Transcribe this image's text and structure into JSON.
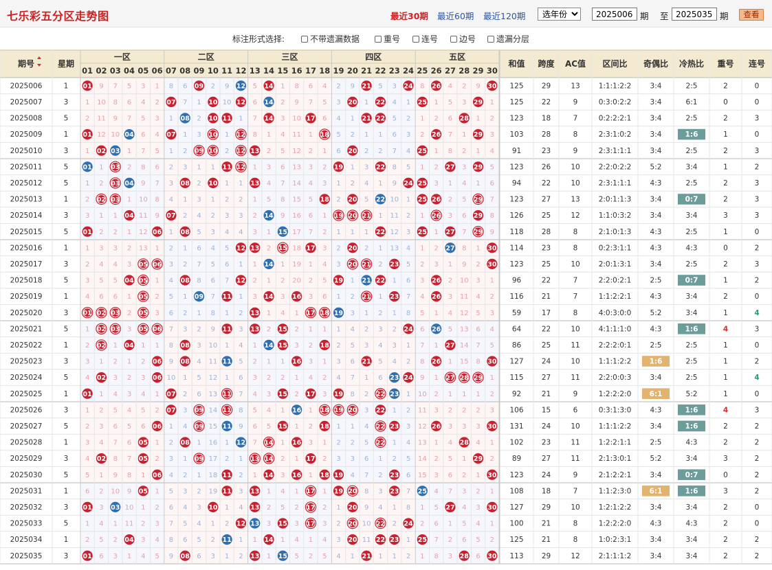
{
  "header": {
    "title": "七乐彩五分区走势图",
    "ranges": [
      "最近30期",
      "最近60期",
      "最近120期"
    ],
    "year_select": "选年份",
    "from_issue": "2025006",
    "issue_unit": "期",
    "to_label": "至",
    "to_issue": "2025035",
    "query_button": "查看"
  },
  "options": {
    "label": "标注形式选择:",
    "items": [
      "不带遗漏数据",
      "重号",
      "连号",
      "边号",
      "遗漏分层"
    ]
  },
  "columns": {
    "issue": "期号",
    "weekday": "星期",
    "zones": [
      "一区",
      "二区",
      "三区",
      "四区",
      "五区"
    ],
    "numbers": [
      "01",
      "02",
      "03",
      "04",
      "05",
      "06",
      "07",
      "08",
      "09",
      "10",
      "11",
      "12",
      "13",
      "14",
      "15",
      "16",
      "17",
      "18",
      "19",
      "20",
      "21",
      "22",
      "23",
      "24",
      "25",
      "26",
      "27",
      "28",
      "29",
      "30"
    ],
    "stats": [
      "和值",
      "跨度",
      "AC值",
      "区间比",
      "奇偶比",
      "冷热比",
      "重号",
      "连号"
    ]
  },
  "rows": [
    {
      "issue": "2025006",
      "week": 1,
      "sum": 125,
      "span": 29,
      "ac": 13,
      "zone": "1:1:1:2:2",
      "oe": "3:4",
      "ch": "2:5",
      "rep": 2,
      "cons": 0
    },
    {
      "issue": "2025007",
      "week": 3,
      "sum": 125,
      "span": 22,
      "ac": 9,
      "zone": "0:3:0:2:2",
      "oe": "3:4",
      "ch": "6:1",
      "rep": 0,
      "cons": 0
    },
    {
      "issue": "2025008",
      "week": 5,
      "sum": 123,
      "span": 18,
      "ac": 7,
      "zone": "0:2:2:2:1",
      "oe": "3:4",
      "ch": "2:5",
      "rep": 2,
      "cons": 3
    },
    {
      "issue": "2025009",
      "week": 1,
      "sum": 103,
      "span": 28,
      "ac": 8,
      "zone": "2:3:1:0:2",
      "oe": "3:4",
      "ch": "1:6",
      "rep": 1,
      "cons": 0
    },
    {
      "issue": "2025010",
      "week": 3,
      "sum": 91,
      "span": 23,
      "ac": 9,
      "zone": "2:3:1:1:1",
      "oe": "3:4",
      "ch": "2:5",
      "rep": 2,
      "cons": 3
    },
    {
      "issue": "2025011",
      "week": 5,
      "sum": 123,
      "span": 26,
      "ac": 10,
      "zone": "2:2:0:2:2",
      "oe": "5:2",
      "ch": "3:4",
      "rep": 1,
      "cons": 2
    },
    {
      "issue": "2025012",
      "week": 5,
      "sum": 94,
      "span": 22,
      "ac": 10,
      "zone": "2:3:1:1:1",
      "oe": "4:3",
      "ch": "2:5",
      "rep": 2,
      "cons": 3
    },
    {
      "issue": "2025013",
      "week": 1,
      "sum": 123,
      "span": 27,
      "ac": 13,
      "zone": "2:0:1:1:3",
      "oe": "3:4",
      "ch": "0:7",
      "rep": 2,
      "cons": 3
    },
    {
      "issue": "2025014",
      "week": 3,
      "sum": 126,
      "span": 25,
      "ac": 12,
      "zone": "1:1:0:3:2",
      "oe": "3:4",
      "ch": "3:4",
      "rep": 3,
      "cons": 3
    },
    {
      "issue": "2025015",
      "week": 5,
      "sum": 118,
      "span": 28,
      "ac": 8,
      "zone": "2:1:0:1:3",
      "oe": "4:3",
      "ch": "2:5",
      "rep": 1,
      "cons": 0
    },
    {
      "issue": "2025016",
      "week": 1,
      "sum": 114,
      "span": 23,
      "ac": 8,
      "zone": "0:2:3:1:1",
      "oe": "4:3",
      "ch": "4:3",
      "rep": 0,
      "cons": 2
    },
    {
      "issue": "2025017",
      "week": 3,
      "sum": 123,
      "span": 25,
      "ac": 10,
      "zone": "2:0:1:3:1",
      "oe": "3:4",
      "ch": "2:5",
      "rep": 2,
      "cons": 3
    },
    {
      "issue": "2025018",
      "week": 5,
      "sum": 96,
      "span": 22,
      "ac": 7,
      "zone": "2:2:0:2:1",
      "oe": "2:5",
      "ch": "0:7",
      "rep": 1,
      "cons": 2
    },
    {
      "issue": "2025019",
      "week": 1,
      "sum": 116,
      "span": 21,
      "ac": 7,
      "zone": "1:1:2:2:1",
      "oe": "4:3",
      "ch": "3:4",
      "rep": 2,
      "cons": 0
    },
    {
      "issue": "2025020",
      "week": 3,
      "sum": 59,
      "span": 17,
      "ac": 8,
      "zone": "4:0:3:0:0",
      "oe": "5:2",
      "ch": "3:4",
      "rep": 1,
      "cons": 4
    },
    {
      "issue": "2025021",
      "week": 5,
      "sum": 64,
      "span": 22,
      "ac": 10,
      "zone": "4:1:1:1:0",
      "oe": "4:3",
      "ch": "1:6",
      "rep": 4,
      "cons": 3
    },
    {
      "issue": "2025022",
      "week": 1,
      "sum": 86,
      "span": 25,
      "ac": 11,
      "zone": "2:2:2:0:1",
      "oe": "2:5",
      "ch": "2:5",
      "rep": 1,
      "cons": 0
    },
    {
      "issue": "2025023",
      "week": 3,
      "sum": 127,
      "span": 24,
      "ac": 10,
      "zone": "1:1:1:2:2",
      "oe": "1:6",
      "ch": "2:5",
      "rep": 1,
      "cons": 2
    },
    {
      "issue": "2025024",
      "week": 5,
      "sum": 115,
      "span": 27,
      "ac": 11,
      "zone": "2:2:0:0:3",
      "oe": "3:4",
      "ch": "2:5",
      "rep": 1,
      "cons": 4
    },
    {
      "issue": "2025025",
      "week": 1,
      "sum": 92,
      "span": 21,
      "ac": 9,
      "zone": "1:2:2:2:0",
      "oe": "6:1",
      "ch": "5:2",
      "rep": 1,
      "cons": 0
    },
    {
      "issue": "2025026",
      "week": 3,
      "sum": 106,
      "span": 15,
      "ac": 6,
      "zone": "0:3:1:3:0",
      "oe": "4:3",
      "ch": "1:6",
      "rep": 4,
      "cons": 3
    },
    {
      "issue": "2025027",
      "week": 5,
      "sum": 131,
      "span": 24,
      "ac": 10,
      "zone": "1:1:1:2:2",
      "oe": "3:4",
      "ch": "1:6",
      "rep": 2,
      "cons": 2
    },
    {
      "issue": "2025028",
      "week": 1,
      "sum": 102,
      "span": 23,
      "ac": 11,
      "zone": "1:2:2:1:1",
      "oe": "2:5",
      "ch": "4:3",
      "rep": 2,
      "cons": 2
    },
    {
      "issue": "2025029",
      "week": 3,
      "sum": 89,
      "span": 27,
      "ac": 11,
      "zone": "2:1:3:0:1",
      "oe": "5:2",
      "ch": "3:4",
      "rep": 3,
      "cons": 2
    },
    {
      "issue": "2025030",
      "week": 5,
      "sum": 123,
      "span": 24,
      "ac": 9,
      "zone": "2:1:2:2:1",
      "oe": "3:4",
      "ch": "0:7",
      "rep": 0,
      "cons": 2
    },
    {
      "issue": "2025031",
      "week": 1,
      "sum": 108,
      "span": 18,
      "ac": 7,
      "zone": "1:1:2:3:0",
      "oe": "6:1",
      "ch": "1:6",
      "rep": 3,
      "cons": 2
    },
    {
      "issue": "2025032",
      "week": 3,
      "sum": 127,
      "span": 29,
      "ac": 10,
      "zone": "1:2:1:2:2",
      "oe": "3:4",
      "ch": "3:4",
      "rep": 2,
      "cons": 0
    },
    {
      "issue": "2025033",
      "week": 5,
      "sum": 100,
      "span": 21,
      "ac": 8,
      "zone": "1:2:2:2:0",
      "oe": "4:3",
      "ch": "4:3",
      "rep": 2,
      "cons": 0
    },
    {
      "issue": "2025034",
      "week": 1,
      "sum": 125,
      "span": 21,
      "ac": 8,
      "zone": "1:0:2:3:1",
      "oe": "3:4",
      "ch": "3:4",
      "rep": 2,
      "cons": 2
    },
    {
      "issue": "2025035",
      "week": 3,
      "sum": 113,
      "span": 29,
      "ac": 12,
      "zone": "2:1:1:1:2",
      "oe": "3:4",
      "ch": "3:4",
      "rep": 2,
      "cons": 2
    }
  ],
  "draws": [
    {
      "red": [
        1,
        9,
        14,
        21,
        24,
        26,
        30
      ],
      "hollow": [],
      "blue": [
        12
      ]
    },
    {
      "red": [
        7,
        10,
        12,
        20,
        22,
        25,
        29
      ],
      "hollow": [],
      "blue": [
        14
      ]
    },
    {
      "red": [
        10,
        11,
        14,
        17,
        21,
        22,
        28
      ],
      "hollow": [],
      "blue": [
        8
      ]
    },
    {
      "red": [
        1,
        7,
        26,
        29
      ],
      "hollow": [
        10,
        12,
        18
      ],
      "blue": [
        4
      ]
    },
    {
      "red": [
        2,
        13,
        20,
        25
      ],
      "hollow": [
        9,
        10,
        12
      ],
      "blue": [
        3
      ]
    },
    {
      "red": [
        11,
        19,
        22,
        27,
        29
      ],
      "hollow": [
        3,
        12
      ],
      "blue": [
        1
      ]
    },
    {
      "red": [
        8,
        10,
        13,
        24,
        25
      ],
      "hollow": [
        3
      ],
      "blue": [
        4
      ]
    },
    {
      "red": [
        18,
        20,
        25,
        26
      ],
      "hollow": [
        2,
        3,
        29
      ],
      "blue": [
        22
      ]
    },
    {
      "red": [
        4,
        7,
        29
      ],
      "hollow": [
        19,
        20,
        21,
        26
      ],
      "blue": [
        14
      ]
    },
    {
      "red": [
        1,
        6,
        8,
        22,
        25,
        27
      ],
      "hollow": [
        29
      ],
      "blue": [
        15
      ]
    },
    {
      "red": [
        12,
        13,
        17,
        20,
        30
      ],
      "hollow": [
        15
      ],
      "blue": [
        27
      ]
    },
    {
      "red": [
        23,
        30
      ],
      "hollow": [
        5,
        6,
        20,
        21
      ],
      "blue": [
        14
      ]
    },
    {
      "red": [
        4,
        8,
        12,
        19,
        22,
        26
      ],
      "hollow": [
        5
      ],
      "blue": [
        21
      ]
    },
    {
      "red": [
        11,
        14,
        16,
        23,
        26
      ],
      "hollow": [
        5,
        21
      ],
      "blue": [
        9
      ]
    },
    {
      "red": [
        13
      ],
      "hollow": [
        1,
        2,
        3,
        5,
        17,
        18
      ],
      "blue": [
        19
      ]
    },
    {
      "red": [
        11,
        13,
        15,
        24
      ],
      "hollow": [
        2,
        3,
        5,
        6
      ],
      "blue": [
        26
      ]
    },
    {
      "red": [
        4,
        8,
        15,
        18,
        27
      ],
      "hollow": [
        2
      ],
      "blue": [
        14
      ]
    },
    {
      "red": [
        6,
        8,
        16,
        21,
        26,
        30
      ],
      "hollow": [],
      "blue": [
        11
      ]
    },
    {
      "red": [
        2,
        6,
        24
      ],
      "hollow": [
        27,
        28,
        29
      ],
      "blue": [
        23
      ]
    },
    {
      "red": [
        1,
        7,
        15,
        17,
        19
      ],
      "hollow": [
        11,
        22
      ],
      "blue": [
        23
      ]
    },
    {
      "red": [
        7,
        22
      ],
      "hollow": [
        9,
        11,
        18,
        19,
        20
      ],
      "blue": [
        16
      ]
    },
    {
      "red": [
        6,
        15,
        18,
        23,
        26,
        30
      ],
      "hollow": [
        9,
        22
      ],
      "blue": [
        11
      ]
    },
    {
      "red": [
        5,
        8,
        16,
        28
      ],
      "hollow": [
        14,
        22
      ],
      "blue": [
        12
      ]
    },
    {
      "red": [
        2,
        5,
        17,
        29
      ],
      "hollow": [
        9,
        13,
        14
      ],
      "blue": []
    },
    {
      "red": [
        6,
        11,
        14,
        16,
        18,
        19,
        23,
        30
      ],
      "hollow": [],
      "blue": []
    },
    {
      "red": [
        5,
        11,
        13,
        19,
        23
      ],
      "hollow": [
        17,
        20
      ],
      "blue": [
        25
      ]
    },
    {
      "red": [
        1,
        10,
        13,
        20,
        27,
        30
      ],
      "hollow": [
        17
      ],
      "blue": [
        3
      ]
    },
    {
      "red": [
        12,
        15,
        24
      ],
      "hollow": [
        17,
        20,
        22
      ],
      "blue": [
        13
      ]
    },
    {
      "red": [
        4,
        14,
        20,
        22,
        23,
        25
      ],
      "hollow": [],
      "blue": [
        11
      ]
    },
    {
      "red": [
        1,
        8,
        13,
        21,
        28,
        30
      ],
      "hollow": [],
      "blue": [
        15
      ]
    }
  ],
  "highlight_cells": [
    {
      "row": 3,
      "col": "ch",
      "kind": "teal"
    },
    {
      "row": 7,
      "col": "ch",
      "kind": "teal"
    },
    {
      "row": 12,
      "col": "ch",
      "kind": "teal"
    },
    {
      "row": 15,
      "col": "ch",
      "kind": "teal"
    },
    {
      "row": 17,
      "col": "oe",
      "kind": "tan"
    },
    {
      "row": 19,
      "col": "oe",
      "kind": "tan"
    },
    {
      "row": 20,
      "col": "ch",
      "kind": "teal"
    },
    {
      "row": 21,
      "col": "ch",
      "kind": "teal"
    },
    {
      "row": 24,
      "col": "ch",
      "kind": "teal"
    },
    {
      "row": 25,
      "col": "oe",
      "kind": "tan"
    },
    {
      "row": 25,
      "col": "ch",
      "kind": "teal"
    }
  ],
  "colored_values": [
    {
      "row": 14,
      "col": "cons",
      "color": "#2a9a7a"
    },
    {
      "row": 15,
      "col": "rep",
      "color": "#d03030"
    },
    {
      "row": 18,
      "col": "cons",
      "color": "#2a9a7a"
    },
    {
      "row": 20,
      "col": "rep",
      "color": "#d03030"
    }
  ],
  "colors": {
    "red_ball": "#c8202f",
    "blue_ball": "#2d6fb0",
    "teal_badge": "#6c9d9b",
    "tan_badge": "#e2b36e",
    "header_bg": "#f3ead1",
    "title": "#cc2222"
  }
}
